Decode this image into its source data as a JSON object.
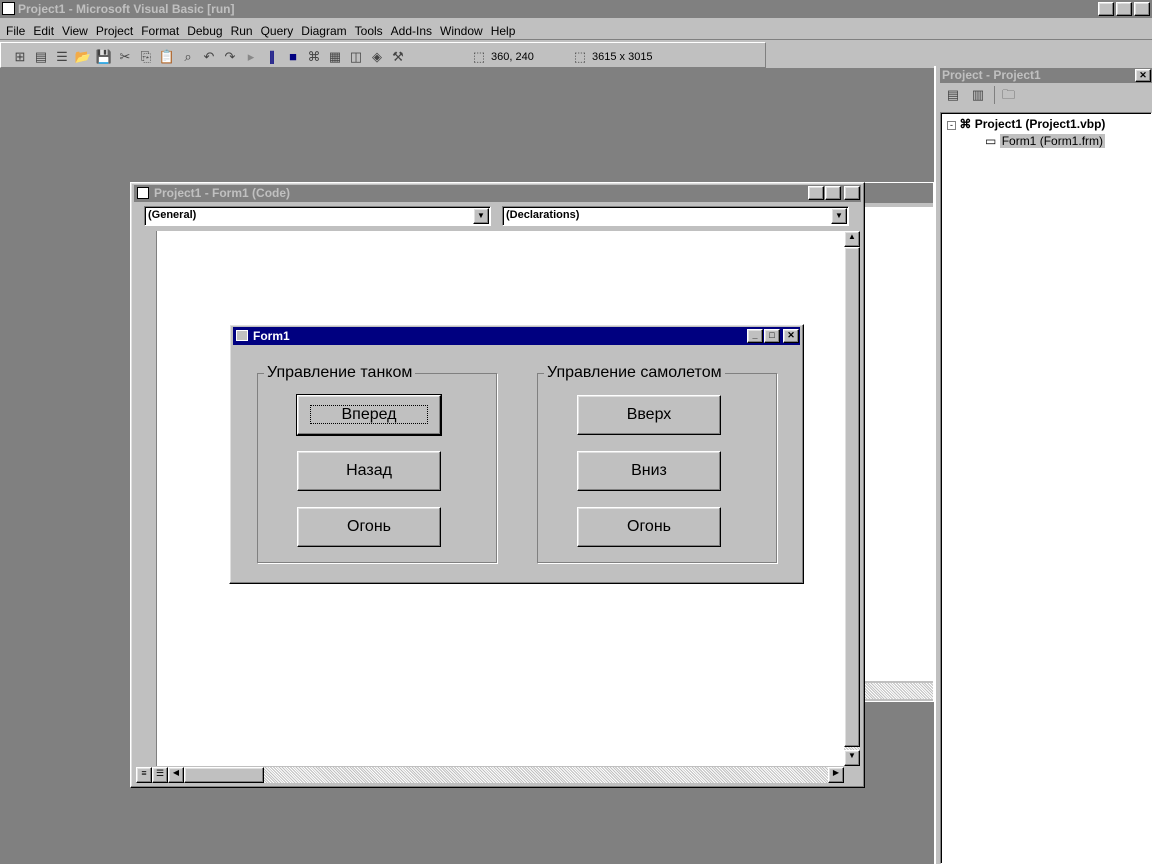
{
  "app": {
    "title": "Project1 - Microsoft Visual Basic [run]"
  },
  "menu": [
    "File",
    "Edit",
    "View",
    "Project",
    "Format",
    "Debug",
    "Run",
    "Query",
    "Diagram",
    "Tools",
    "Add-Ins",
    "Window",
    "Help"
  ],
  "toolbar": {
    "position": "360, 240",
    "size": "3615 x 3015"
  },
  "project_panel": {
    "title": "Project - Project1",
    "project": "Project1 (Project1.vbp)",
    "form": "Form1 (Form1.frm)"
  },
  "code_window": {
    "title": "Project1 - Form1 (Code)",
    "object_combo": "(General)",
    "proc_combo": "(Declarations)"
  },
  "form1": {
    "title": "Form1",
    "tank_frame": {
      "label": "Управление танком",
      "buttons": [
        "Вперед",
        "Назад",
        "Огонь"
      ]
    },
    "plane_frame": {
      "label": "Управление самолетом",
      "buttons": [
        "Вверх",
        "Вниз",
        "Огонь"
      ]
    }
  }
}
